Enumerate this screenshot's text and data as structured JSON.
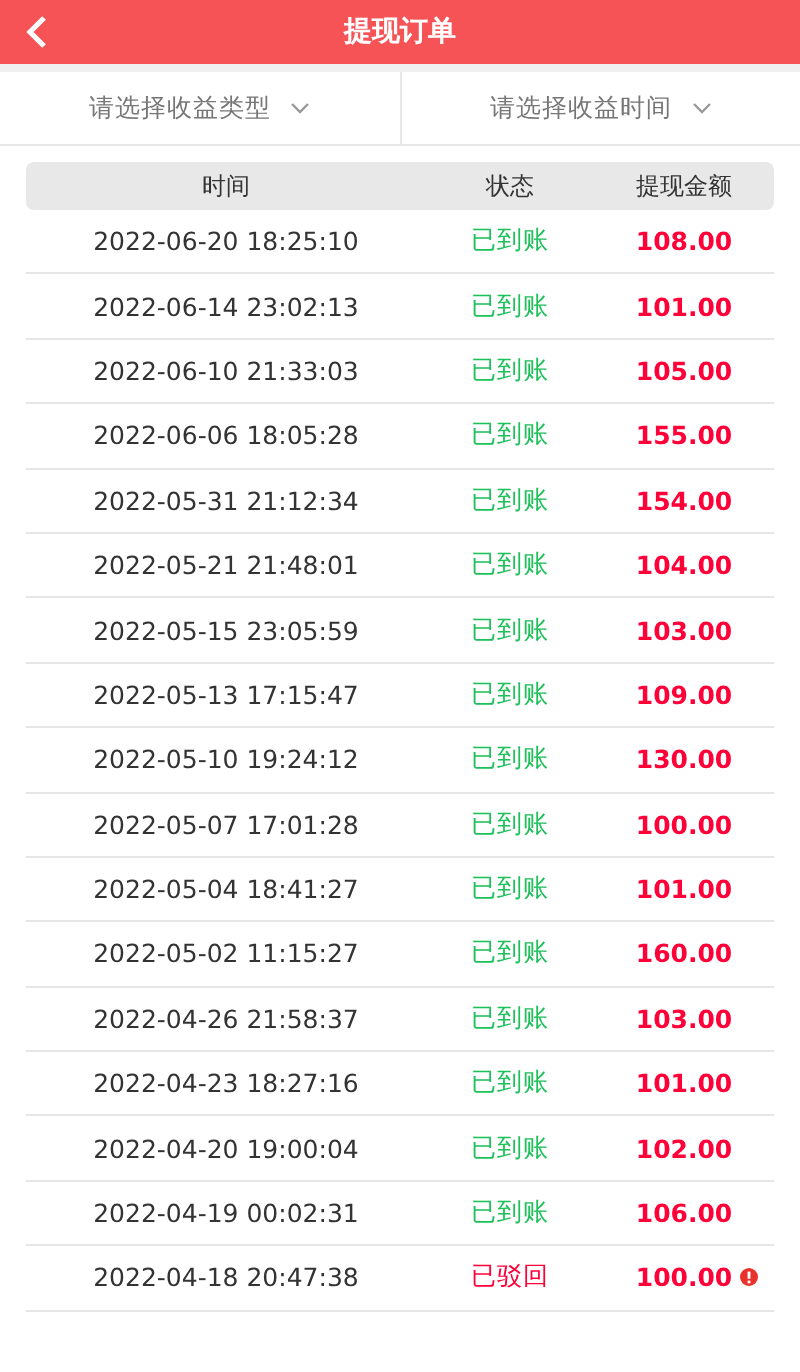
{
  "header": {
    "title": "提现订单"
  },
  "filters": [
    {
      "placeholder": "请选择收益类型"
    },
    {
      "placeholder": "请选择收益时间"
    }
  ],
  "table": {
    "columns": [
      "时间",
      "状态",
      "提现金额"
    ],
    "rows": [
      {
        "time": "2022-06-20 18:25:10",
        "status": "已到账",
        "kind": "paid",
        "amount": "108.00"
      },
      {
        "time": "2022-06-14 23:02:13",
        "status": "已到账",
        "kind": "paid",
        "amount": "101.00"
      },
      {
        "time": "2022-06-10 21:33:03",
        "status": "已到账",
        "kind": "paid",
        "amount": "105.00"
      },
      {
        "time": "2022-06-06 18:05:28",
        "status": "已到账",
        "kind": "paid",
        "amount": "155.00"
      },
      {
        "time": "2022-05-31 21:12:34",
        "status": "已到账",
        "kind": "paid",
        "amount": "154.00"
      },
      {
        "time": "2022-05-21 21:48:01",
        "status": "已到账",
        "kind": "paid",
        "amount": "104.00"
      },
      {
        "time": "2022-05-15 23:05:59",
        "status": "已到账",
        "kind": "paid",
        "amount": "103.00"
      },
      {
        "time": "2022-05-13 17:15:47",
        "status": "已到账",
        "kind": "paid",
        "amount": "109.00"
      },
      {
        "time": "2022-05-10 19:24:12",
        "status": "已到账",
        "kind": "paid",
        "amount": "130.00"
      },
      {
        "time": "2022-05-07 17:01:28",
        "status": "已到账",
        "kind": "paid",
        "amount": "100.00"
      },
      {
        "time": "2022-05-04 18:41:27",
        "status": "已到账",
        "kind": "paid",
        "amount": "101.00"
      },
      {
        "time": "2022-05-02 11:15:27",
        "status": "已到账",
        "kind": "paid",
        "amount": "160.00"
      },
      {
        "time": "2022-04-26 21:58:37",
        "status": "已到账",
        "kind": "paid",
        "amount": "103.00"
      },
      {
        "time": "2022-04-23 18:27:16",
        "status": "已到账",
        "kind": "paid",
        "amount": "101.00"
      },
      {
        "time": "2022-04-20 19:00:04",
        "status": "已到账",
        "kind": "paid",
        "amount": "102.00"
      },
      {
        "time": "2022-04-19 00:02:31",
        "status": "已到账",
        "kind": "paid",
        "amount": "106.00"
      },
      {
        "time": "2022-04-18 20:47:38",
        "status": "已驳回",
        "kind": "rejected",
        "amount": "100.00"
      }
    ]
  }
}
